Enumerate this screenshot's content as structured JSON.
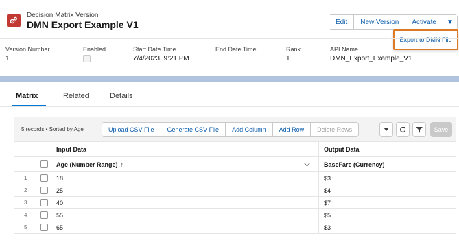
{
  "header": {
    "eyebrow": "Decision Matrix Version",
    "title": "DMN Export Example V1",
    "actions": {
      "edit": "Edit",
      "new_version": "New Version",
      "activate": "Activate",
      "menu_caret": "▼"
    },
    "dropdown": {
      "export_dmn": "Export to DMN File"
    },
    "fields": {
      "version_number_label": "Version Number",
      "version_number_value": "1",
      "enabled_label": "Enabled",
      "start_label": "Start Date Time",
      "start_value": "7/4/2023, 9:21 PM",
      "end_label": "End Date Time",
      "end_value": "",
      "rank_label": "Rank",
      "rank_value": "1",
      "api_label": "API Name",
      "api_value": "DMN_Export_Example_V1"
    }
  },
  "tabs": {
    "matrix": "Matrix",
    "related": "Related",
    "details": "Details"
  },
  "toolbar": {
    "records_info": "5 records • Sorted by Age",
    "upload_csv": "Upload CSV File",
    "generate_csv": "Generate CSV File",
    "add_column": "Add Column",
    "add_row": "Add Row",
    "delete_rows": "Delete Rows",
    "save": "Save"
  },
  "grid": {
    "input_group": "Input Data",
    "output_group": "Output Data",
    "input_col": "Age (Number Range)",
    "sort_arrow": "↑",
    "output_col": "BaseFare (Currency)",
    "rows": [
      {
        "num": "1",
        "age": "18",
        "fare": "$3"
      },
      {
        "num": "2",
        "age": "25",
        "fare": "$4"
      },
      {
        "num": "3",
        "age": "40",
        "fare": "$7"
      },
      {
        "num": "4",
        "age": "55",
        "fare": "$5"
      },
      {
        "num": "5",
        "age": "65",
        "fare": "$3"
      }
    ]
  },
  "colors": {
    "brand_blue": "#0b5cab",
    "active_tab": "#0176d3",
    "icon_bg": "#c23934",
    "highlight": "#dd7a27"
  }
}
